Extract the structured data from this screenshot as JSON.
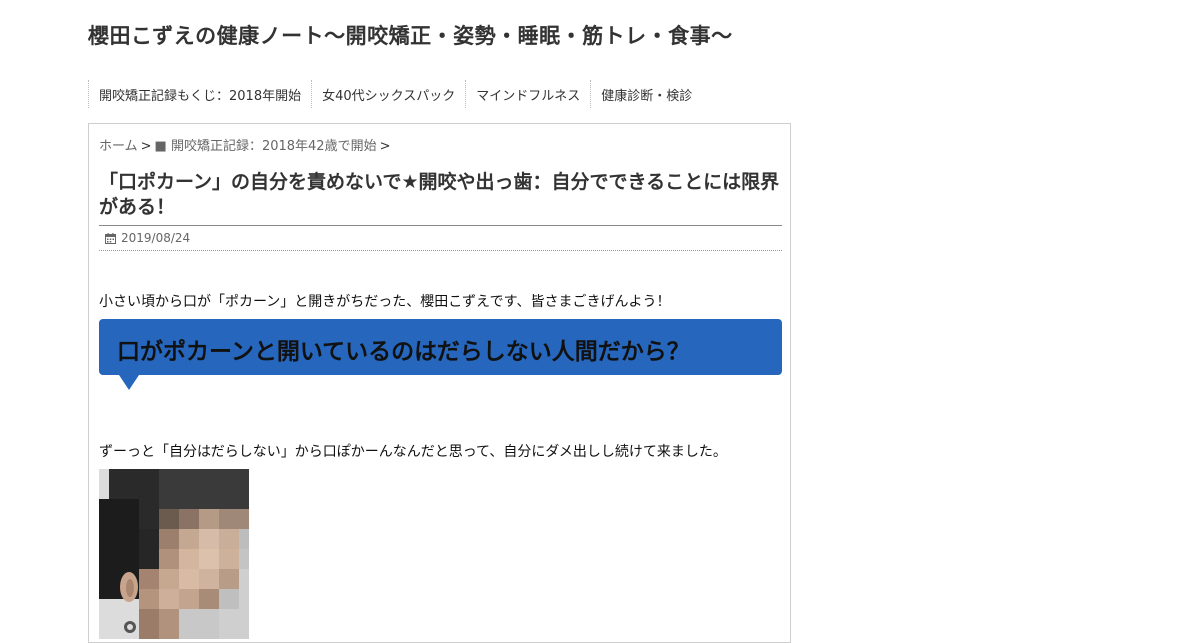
{
  "site": {
    "title": "櫻田こずえの健康ノート〜開咬矯正・姿勢・睡眠・筋トレ・食事〜"
  },
  "nav": {
    "items": [
      {
        "label": "開咬矯正記録もくじ：2018年開始"
      },
      {
        "label": "女40代シックスパック"
      },
      {
        "label": "マインドフルネス"
      },
      {
        "label": "健康診断・検診"
      }
    ]
  },
  "breadcrumb": {
    "home": "ホーム",
    "category": "■ 開咬矯正記録：2018年42歳で開始",
    "separator": ">"
  },
  "post": {
    "title": "「口ポカーン」の自分を責めないで★開咬や出っ歯：自分でできることには限界がある！",
    "date": "2019/08/24",
    "date_icon": "calendar-icon",
    "intro": "小さい頃から口が「ポカーン」と開きがちだった、櫻田こずえです、皆さまごきげんよう！",
    "heading": "口がポカーンと開いているのはだらしない人間だから？",
    "heading_color": "#2667bd",
    "paragraph2": "ずーっと「自分はだらしない」から口ぽかーんなんだと思って、自分にダメ出しし続けて来ました。"
  }
}
